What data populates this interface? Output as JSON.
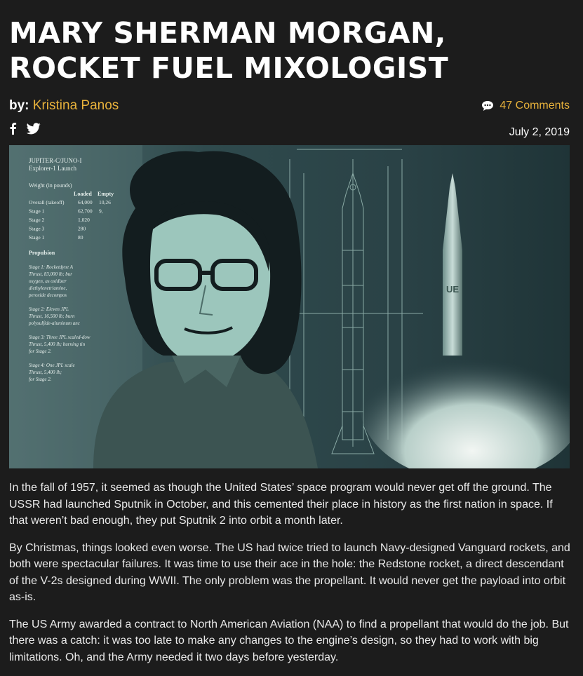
{
  "article": {
    "title": "MARY SHERMAN MORGAN, ROCKET FUEL MIXOLOGIST",
    "byline_prefix": "by:",
    "author": "Kristina Panos",
    "comments": "47 Comments",
    "date": "July 2, 2019",
    "paragraphs": [
      "In the fall of 1957, it seemed as though the United States’ space program would never get off the ground. The USSR had launched Sputnik in October, and this cemented their place in history as the first nation in space. If that weren’t bad enough, they put Sputnik 2 into orbit a month later.",
      "By Christmas, things looked even worse. The US had twice tried to launch Navy-designed Vanguard rockets, and both were spectacular failures. It was time to use their ace in the hole: the Redstone rocket, a direct descendant of the V-2s designed during WWII. The only problem was the propellant. It would never get the payload into orbit as-is.",
      "The US Army awarded a contract to North American Aviation (NAA) to find a propellant that would do the job. But there was a catch: it was too late to make any changes to the engine’s design, so they had to work with big limitations. Oh, and the Army needed it two days before yesterday."
    ]
  },
  "hero_image": {
    "heading_1": "JUPITER-C/JUNO-I",
    "heading_2": "Explorer-1 Launch",
    "weight_label": "Weight (in pounds)",
    "col_loaded": "Loaded",
    "col_empty": "Empty",
    "rows": [
      {
        "label": "Overall (takeoff)",
        "loaded": "64,000",
        "empty": "10,26"
      },
      {
        "label": "Stage 1",
        "loaded": "62,700",
        "empty": "9,"
      },
      {
        "label": "Stage 2",
        "loaded": "1,020",
        "empty": ""
      },
      {
        "label": "Stage 3",
        "loaded": "280",
        "empty": ""
      },
      {
        "label": "Stage 1",
        "loaded": "80",
        "empty": ""
      }
    ],
    "propulsion_label": "Propulsion",
    "stage_notes": [
      [
        "Stage 1: Rocketdyne A",
        "Thrust, 83,000 lb; bur",
        "oxygen, as oxidizer",
        "diethylenetriamine,",
        "peroxide decompos"
      ],
      [
        "Stage 2: Eleven JPL",
        "Thrust, 16,500 lb; burn",
        "polysulfide-aluminum anc"
      ],
      [
        "Stage 3: Three JPL scaled-dow",
        "Thrust, 5,400 lb; burning tin",
        "for Stage 2."
      ],
      [
        "Stage 4: One JPL scale",
        "Thrust, 5,400 lb;",
        "for Stage 2."
      ]
    ],
    "rocket_mark": "UE",
    "colors": {
      "teal": "#8fbcb5",
      "dark_teal": "#2c4346",
      "ink": "#131d1f"
    }
  },
  "icons": [
    "facebook-icon",
    "twitter-icon",
    "comment-bubble-icon"
  ],
  "theme": {
    "background": "#1c1c1c",
    "accent": "#e8b23b"
  }
}
